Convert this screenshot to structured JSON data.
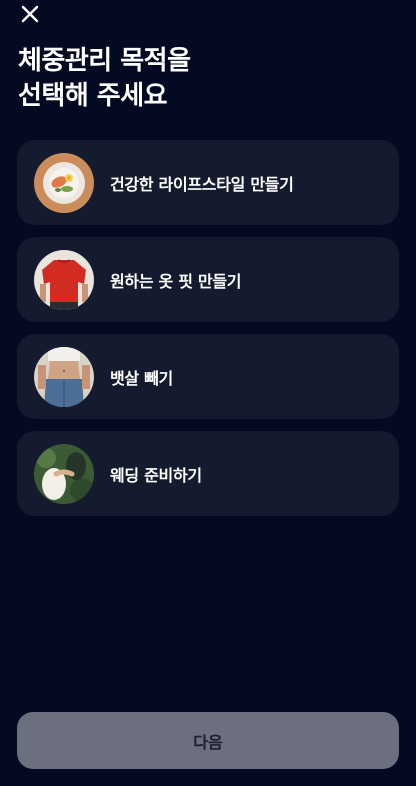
{
  "header": {
    "close_icon": "close-icon",
    "title_line1": "체중관리 목적을",
    "title_line2": "선택해 주세요"
  },
  "options": [
    {
      "label": "건강한 라이프스타일 만들기",
      "icon": "healthy-meal-plate-image"
    },
    {
      "label": "원하는 옷 핏 만들기",
      "icon": "red-tshirt-torso-image"
    },
    {
      "label": "뱃살 빼기",
      "icon": "waist-jeans-image"
    },
    {
      "label": "웨딩 준비하기",
      "icon": "wedding-hands-image"
    }
  ],
  "footer": {
    "next_label": "다음"
  },
  "colors": {
    "background": "#040a22",
    "card": "#141b2e",
    "button": "#6b6f7e",
    "button_text": "#1b1e2b"
  }
}
